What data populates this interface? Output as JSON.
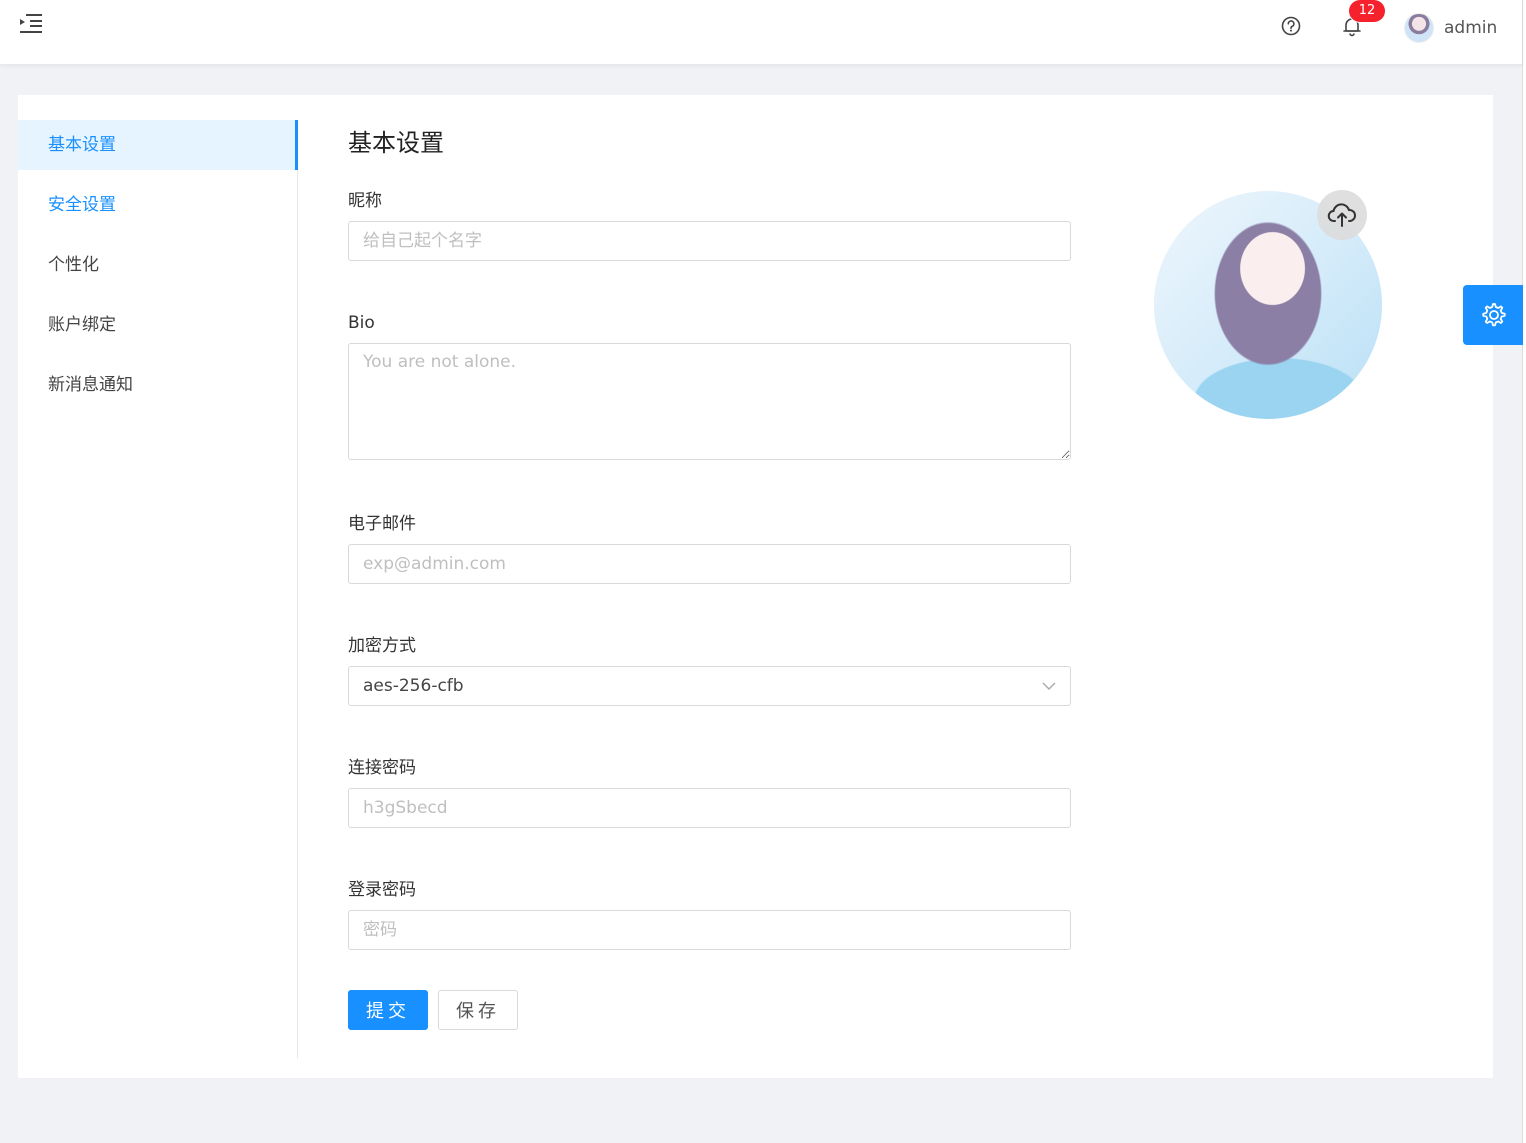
{
  "header": {
    "username": "admin",
    "notification_count": "12",
    "icons": [
      "menu-fold-icon",
      "question-circle-icon",
      "bell-icon"
    ]
  },
  "sidebar": {
    "items": [
      {
        "label": "基本设置"
      },
      {
        "label": "安全设置"
      },
      {
        "label": "个性化"
      },
      {
        "label": "账户绑定"
      },
      {
        "label": "新消息通知"
      }
    ]
  },
  "form": {
    "title": "基本设置",
    "nickname": {
      "label": "昵称",
      "placeholder": "给自己起个名字"
    },
    "bio": {
      "label": "Bio",
      "placeholder": "You are not alone."
    },
    "email": {
      "label": "电子邮件",
      "placeholder": "exp@admin.com"
    },
    "encryption": {
      "label": "加密方式",
      "value": "aes-256-cfb"
    },
    "connect_password": {
      "label": "连接密码",
      "placeholder": "h3gSbecd"
    },
    "login_password": {
      "label": "登录密码",
      "placeholder": "密码"
    },
    "submit_label": "提交",
    "save_label": "保存"
  },
  "colors": {
    "primary": "#1890ff",
    "badge": "#f5222d",
    "active_bg": "#e6f4ff"
  }
}
